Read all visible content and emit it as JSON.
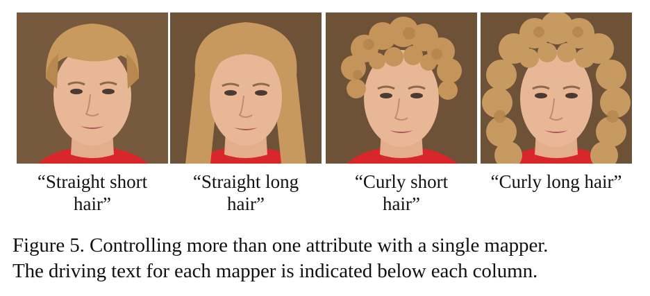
{
  "panels": [
    {
      "label_line1": "“Straight short",
      "label_line2": "hair”",
      "hair_style": "straight-short"
    },
    {
      "label_line1": "“Straight long",
      "label_line2": "hair”",
      "hair_style": "straight-long"
    },
    {
      "label_line1": "“Curly short",
      "label_line2": "hair”",
      "hair_style": "curly-short"
    },
    {
      "label_line1": "“Curly long hair”",
      "label_line2": "",
      "hair_style": "curly-long"
    }
  ],
  "caption": {
    "line1": "Figure 5. Controlling more than one attribute with a single mapper.",
    "line2": "The driving text for each mapper is indicated below each column."
  },
  "colors": {
    "background_warm": "#7a5a3a",
    "hair_blonde": "#c89a5e",
    "skin": "#e8b896",
    "shirt_red": "#d8262a"
  }
}
